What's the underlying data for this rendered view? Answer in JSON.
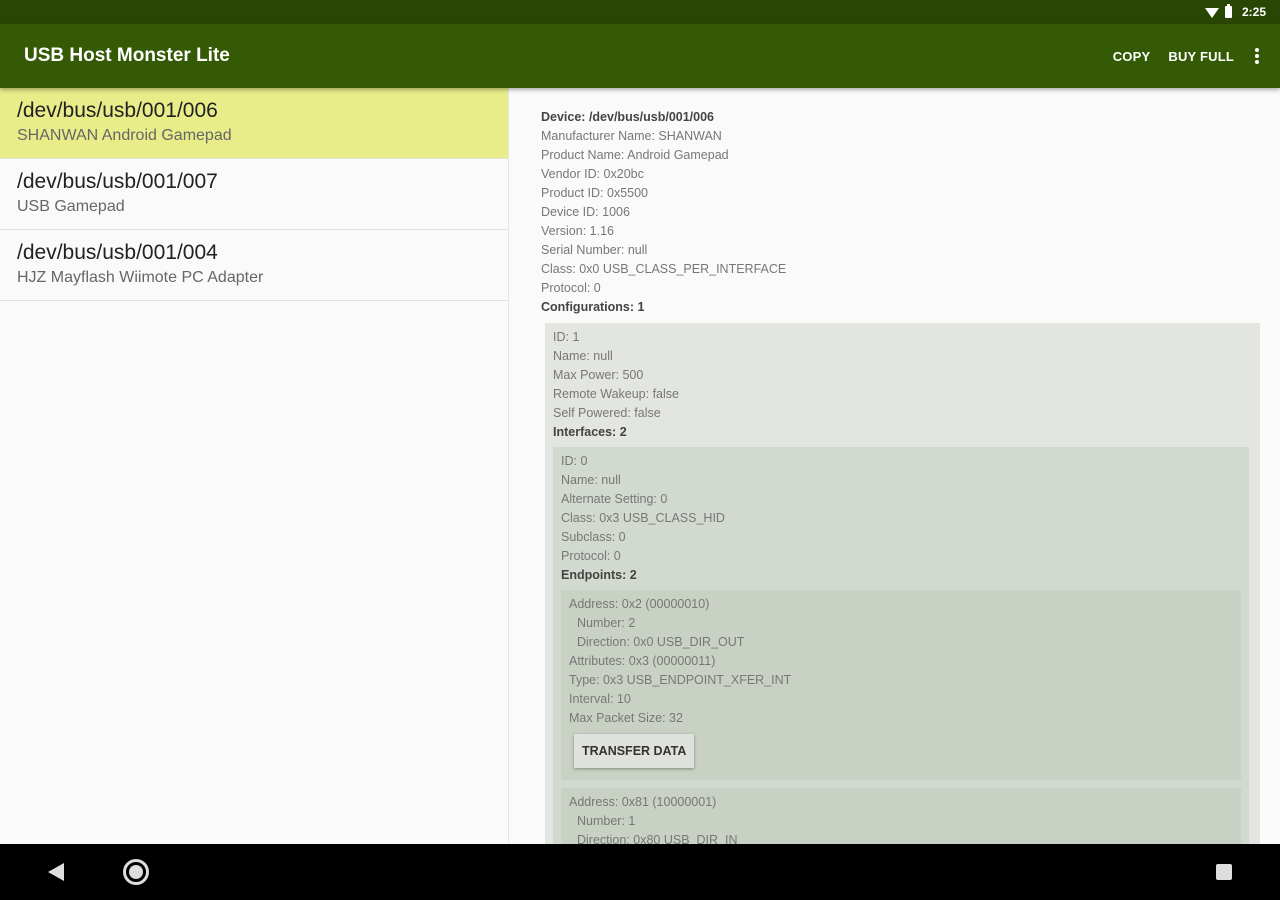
{
  "status_bar": {
    "time": "2:25",
    "wifi_icon": "wifi-icon",
    "battery_icon": "battery-icon"
  },
  "toolbar": {
    "title": "USB Host Monster Lite",
    "copy": "COPY",
    "buy_full": "BUY FULL",
    "overflow_icon": "more-vert-icon"
  },
  "device_list": [
    {
      "path": "/dev/bus/usb/001/006",
      "name": "SHANWAN Android Gamepad"
    },
    {
      "path": "/dev/bus/usb/001/007",
      "name": "USB Gamepad"
    },
    {
      "path": "/dev/bus/usb/001/004",
      "name": "HJZ Mayflash Wiimote PC Adapter"
    }
  ],
  "details": {
    "device": "Device: /dev/bus/usb/001/006",
    "manufacturer": "Manufacturer Name: SHANWAN",
    "product_name": "Product Name: Android Gamepad",
    "vendor_id": "Vendor ID: 0x20bc",
    "product_id": "Product ID: 0x5500",
    "device_id": "Device ID: 1006",
    "version": "Version: 1.16",
    "serial": "Serial Number: null",
    "class": "Class: 0x0 USB_CLASS_PER_INTERFACE",
    "protocol": "Protocol: 0",
    "configurations": "Configurations: 1",
    "config": {
      "id": "ID: 1",
      "name": "Name: null",
      "max_power": "Max Power: 500",
      "remote_wakeup": "Remote Wakeup: false",
      "self_powered": "Self Powered: false",
      "interfaces": "Interfaces: 2",
      "interface": {
        "id": "ID: 0",
        "name": "Name: null",
        "alternate_setting": "Alternate Setting: 0",
        "class": "Class: 0x3 USB_CLASS_HID",
        "subclass": "Subclass: 0",
        "protocol": "Protocol: 0",
        "endpoints": "Endpoints: 2",
        "endpoint1": {
          "address": "Address: 0x2 (00000010)",
          "number": "Number: 2",
          "direction": "Direction: 0x0 USB_DIR_OUT",
          "attributes": "Attributes: 0x3 (00000011)",
          "type": "Type: 0x3 USB_ENDPOINT_XFER_INT",
          "interval": "Interval: 10",
          "max_packet": "Max Packet Size: 32",
          "button": "TRANSFER DATA"
        },
        "endpoint2": {
          "address": "Address: 0x81 (10000001)",
          "number": "Number: 1",
          "direction": "Direction: 0x80 USB_DIR_IN"
        }
      }
    }
  },
  "nav_bar": {
    "back_icon": "back-icon",
    "home_icon": "home-icon",
    "recents_icon": "recents-icon"
  }
}
